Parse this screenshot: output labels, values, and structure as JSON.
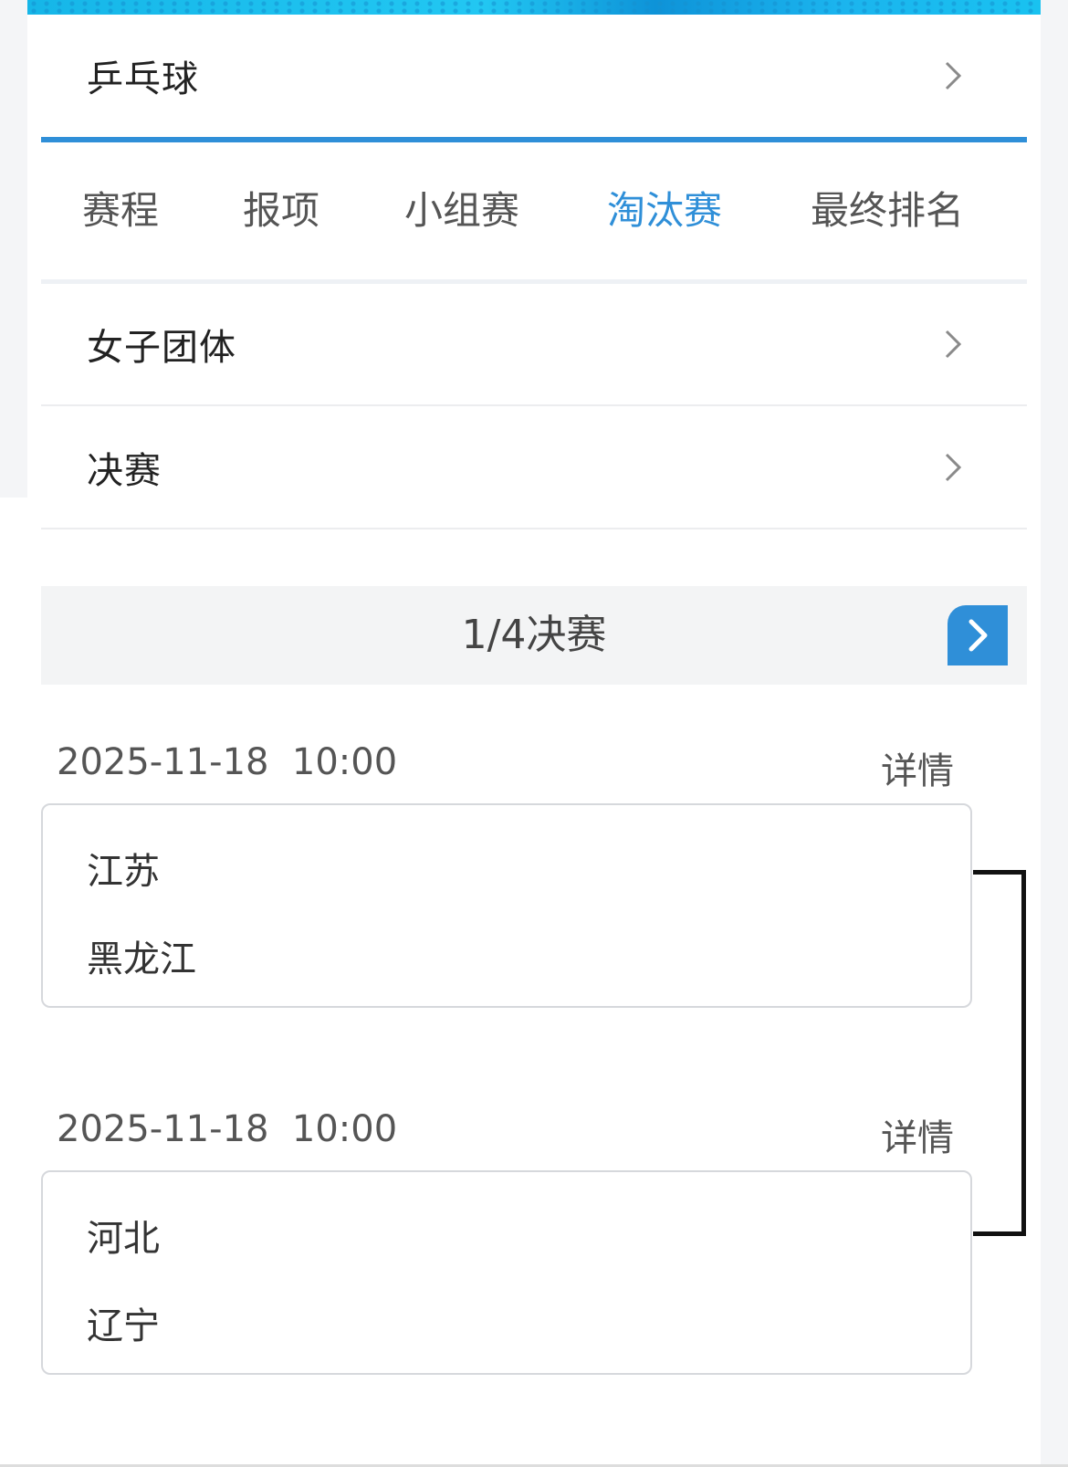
{
  "sport": {
    "label": "乒乓球"
  },
  "tabs": [
    {
      "label": "赛程",
      "active": false
    },
    {
      "label": "报项",
      "active": false
    },
    {
      "label": "小组赛",
      "active": false
    },
    {
      "label": "淘汰赛",
      "active": true
    },
    {
      "label": "最终排名",
      "active": false
    }
  ],
  "event": {
    "label": "女子团体"
  },
  "stage": {
    "label": "决赛"
  },
  "round": {
    "title": "1/4决赛"
  },
  "matches": [
    {
      "datetime": "2025-11-18  10:00",
      "detail_label": "详情",
      "team1": "江苏",
      "team2": "黑龙江"
    },
    {
      "datetime": "2025-11-18  10:00",
      "detail_label": "详情",
      "team1": "河北",
      "team2": "辽宁"
    }
  ],
  "colors": {
    "accent": "#2f8fd8",
    "text": "#333333",
    "muted": "#555555",
    "bar_bg": "#f3f4f5"
  },
  "icons": {
    "row_arrow": "chevron-right-icon",
    "round_next": "chevron-right-icon"
  }
}
